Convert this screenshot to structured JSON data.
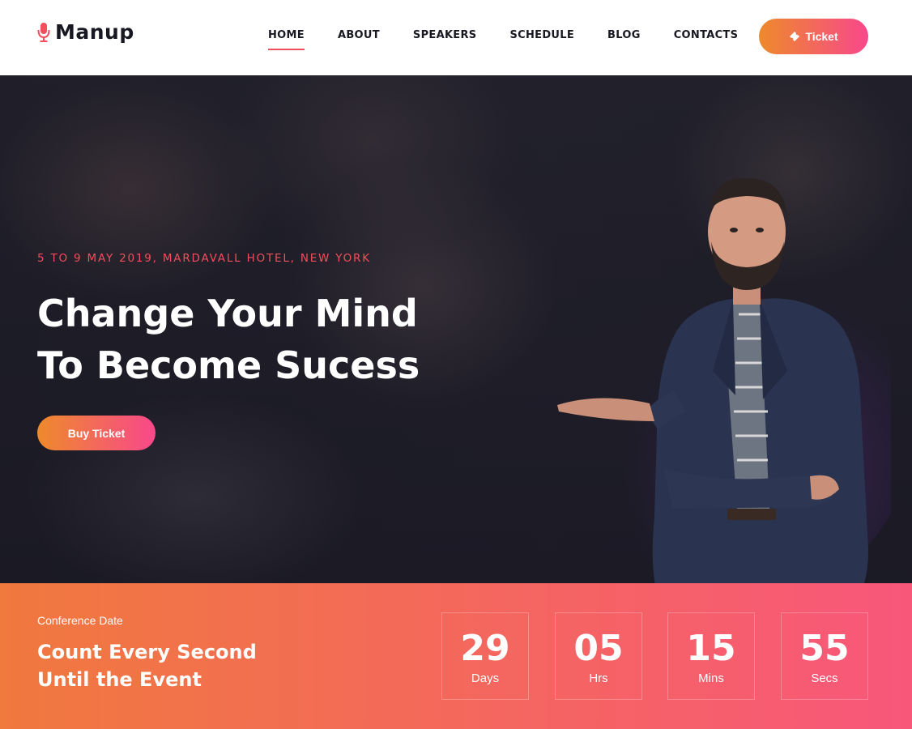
{
  "brand": {
    "name": "Manup"
  },
  "nav": {
    "items": [
      {
        "label": "HOME"
      },
      {
        "label": "ABOUT"
      },
      {
        "label": "SPEAKERS"
      },
      {
        "label": "SCHEDULE"
      },
      {
        "label": "BLOG"
      },
      {
        "label": "CONTACTS"
      }
    ],
    "active": "HOME",
    "ticket_label": "Ticket"
  },
  "hero": {
    "date_location": "5 TO 9 MAY 2019, MARDAVALL HOTEL, NEW YORK",
    "title_line1": "Change Your Mind",
    "title_line2": "To Become Sucess",
    "button_label": "Buy Ticket"
  },
  "countdown": {
    "label": "Conference Date",
    "title_line1": "Count Every Second",
    "title_line2": "Until the Event",
    "units": [
      {
        "value": "29",
        "unit": "Days"
      },
      {
        "value": "05",
        "unit": "Hrs"
      },
      {
        "value": "15",
        "unit": "Mins"
      },
      {
        "value": "55",
        "unit": "Secs"
      }
    ]
  },
  "colors": {
    "accent": "#f24e5c",
    "gradient_start": "#ee8a2b",
    "gradient_end": "#f8488b",
    "dark_text": "#171822",
    "hero_bg": "#1e1d28"
  },
  "icons": {
    "logo": "microphone-icon",
    "ticket": "ticket-icon"
  }
}
